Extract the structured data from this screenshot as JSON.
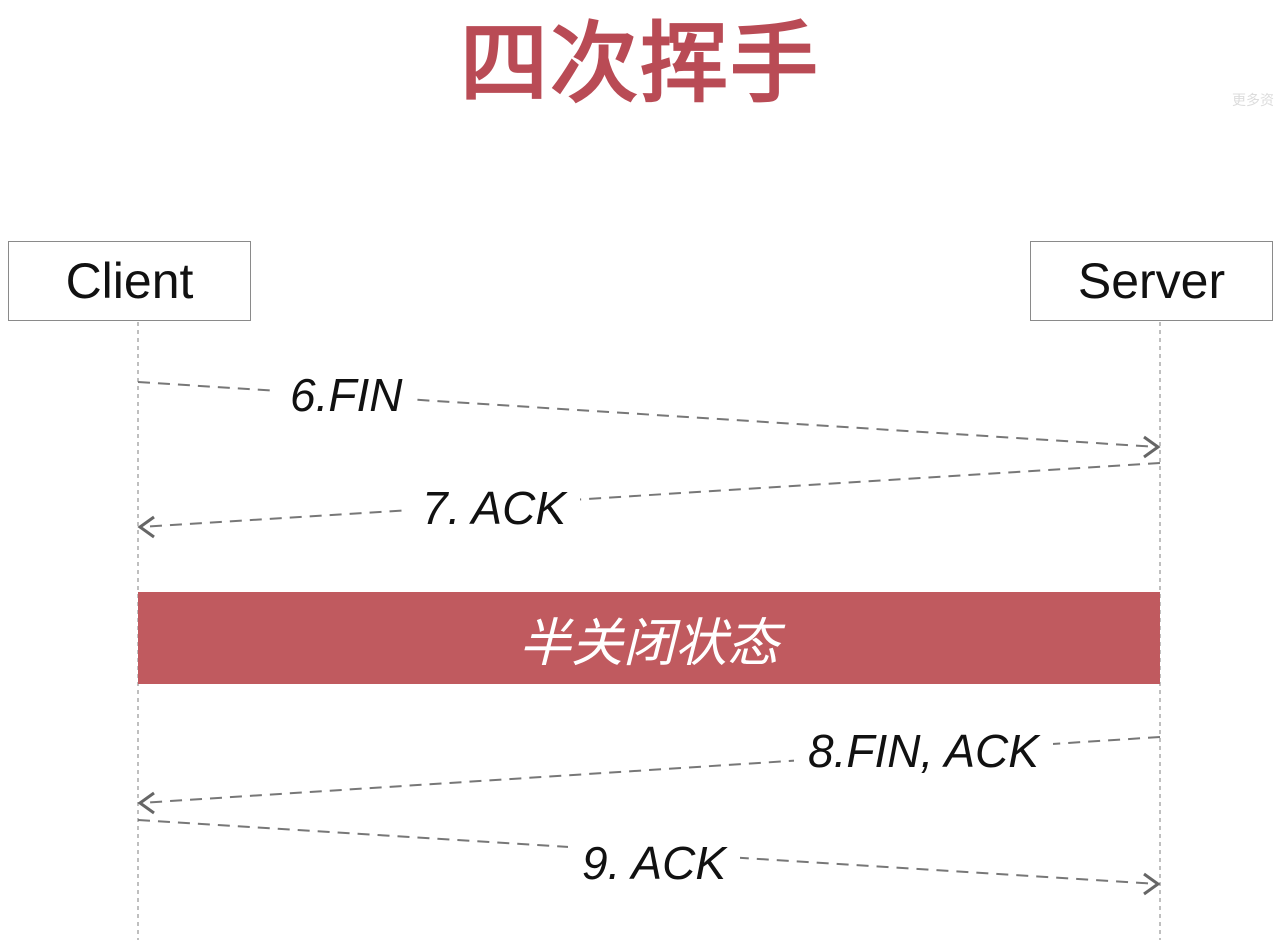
{
  "title": "四次挥手",
  "watermark": "更多资",
  "actors": {
    "client": "Client",
    "server": "Server"
  },
  "messages": [
    {
      "label": "6.FIN",
      "from": "Client",
      "to": "Server"
    },
    {
      "label": "7. ACK",
      "from": "Server",
      "to": "Client"
    },
    {
      "label": "8.FIN, ACK",
      "from": "Server",
      "to": "Client"
    },
    {
      "label": "9. ACK",
      "from": "Client",
      "to": "Server"
    }
  ],
  "state_band": {
    "label": "半关闭状态"
  },
  "colors": {
    "title": "#b94b55",
    "band": "#c05a5f",
    "line": "#777777"
  }
}
